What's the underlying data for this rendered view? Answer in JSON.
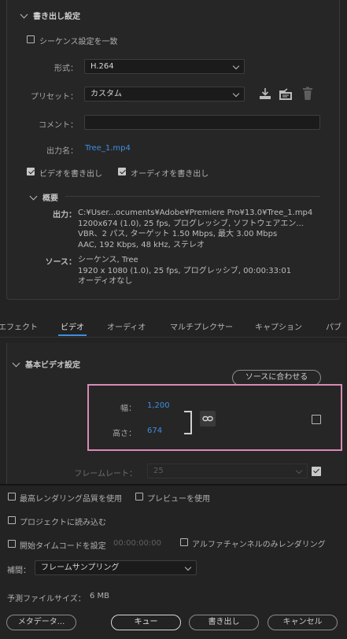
{
  "export_settings": {
    "header": "書き出し設定",
    "match_sequence_label": "シーケンス設定を一致",
    "format_label": "形式：",
    "format_value": "H.264",
    "preset_label": "プリセット：",
    "preset_value": "カスタム",
    "comment_label": "コメント：",
    "comment_value": "",
    "output_name_label": "出力名：",
    "output_name_value": "Tree_1.mp4",
    "export_video_label": "ビデオを書き出し",
    "export_audio_label": "オーディオを書き出し",
    "summary_header": "概要",
    "output_key": "出力：",
    "output_lines": [
      "C:¥User...ocuments¥Adobe¥Premiere Pro¥13.0¥Tree_1.mp4",
      "1200x674 (1.0), 25 fps, プログレッシブ, ソフトウェアエン...",
      "VBR、2 パス, ターゲット 1.50 Mbps, 最大 3.00 Mbps",
      "AAC, 192 Kbps, 48 kHz, ステレオ"
    ],
    "source_key": "ソース：",
    "source_lines": [
      "シーケンス, Tree",
      "1920 x 1080 (1.0), 25 fps, プログレッシブ, 00:00:33:01",
      "オーディオなし"
    ]
  },
  "tabs": [
    "エフェクト",
    "ビデオ",
    "オーディオ",
    "マルチプレクサー",
    "キャプション",
    "パブ"
  ],
  "basic_video": {
    "header": "基本ビデオ設定",
    "match_source_label": "ソースに合わせる",
    "width_label": "幅：",
    "width_value": "1,200",
    "height_label": "高さ：",
    "height_value": "674",
    "frame_rate_label": "フレームレート：",
    "frame_rate_value": "25"
  },
  "bottom": {
    "max_render_quality": "最高レンダリング品質を使用",
    "use_previews": "プレビューを使用",
    "import_into_project": "プロジェクトに読み込む",
    "set_start_timecode": "開始タイムコードを設定",
    "start_timecode_value": "00:00:00:00",
    "render_alpha_only": "アルファチャンネルのみレンダリング",
    "interpolation_label": "補間：",
    "interpolation_value": "フレームサンプリング",
    "estimated_size_label": "予測ファイルサイズ：",
    "estimated_size_value": "6 MB",
    "metadata_button": "メタデータ...",
    "queue_button": "キュー",
    "export_button": "書き出し",
    "cancel_button": "キャンセル"
  },
  "colors": {
    "accent_blue": "#3d8fe0",
    "highlight_box": "#d98ab5"
  }
}
